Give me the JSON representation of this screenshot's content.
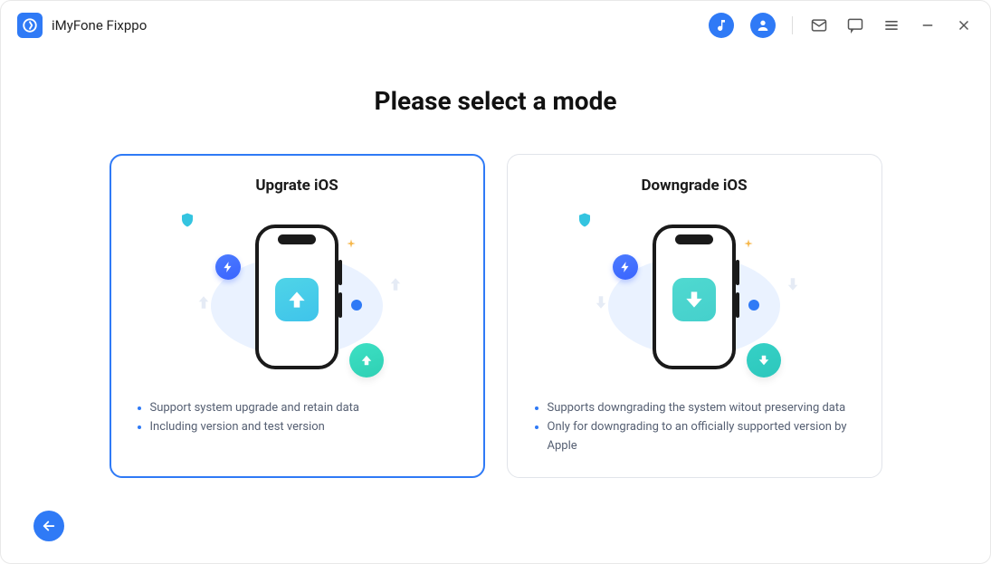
{
  "app": {
    "title": "iMyFone Fixppo"
  },
  "page_heading": "Please select a mode",
  "modes": [
    {
      "title": "Upgrate iOS",
      "direction": "up",
      "selected": true,
      "bullets": [
        "Support system upgrade and retain data",
        "Including version and test version"
      ]
    },
    {
      "title": "Downgrade iOS",
      "direction": "down",
      "selected": false,
      "bullets": [
        "Supports downgrading the system witout preserving data",
        "Only for downgrading to an officially supported version by Apple"
      ]
    }
  ],
  "icons": {
    "music": "music-note-icon",
    "user": "user-icon",
    "mail": "mail-icon",
    "chat": "chat-icon",
    "menu": "menu-icon",
    "minimize": "minimize-icon",
    "close": "close-icon",
    "back": "arrow-left-icon"
  },
  "colors": {
    "accent": "#2f7af6",
    "teal": "#34d0c4"
  }
}
